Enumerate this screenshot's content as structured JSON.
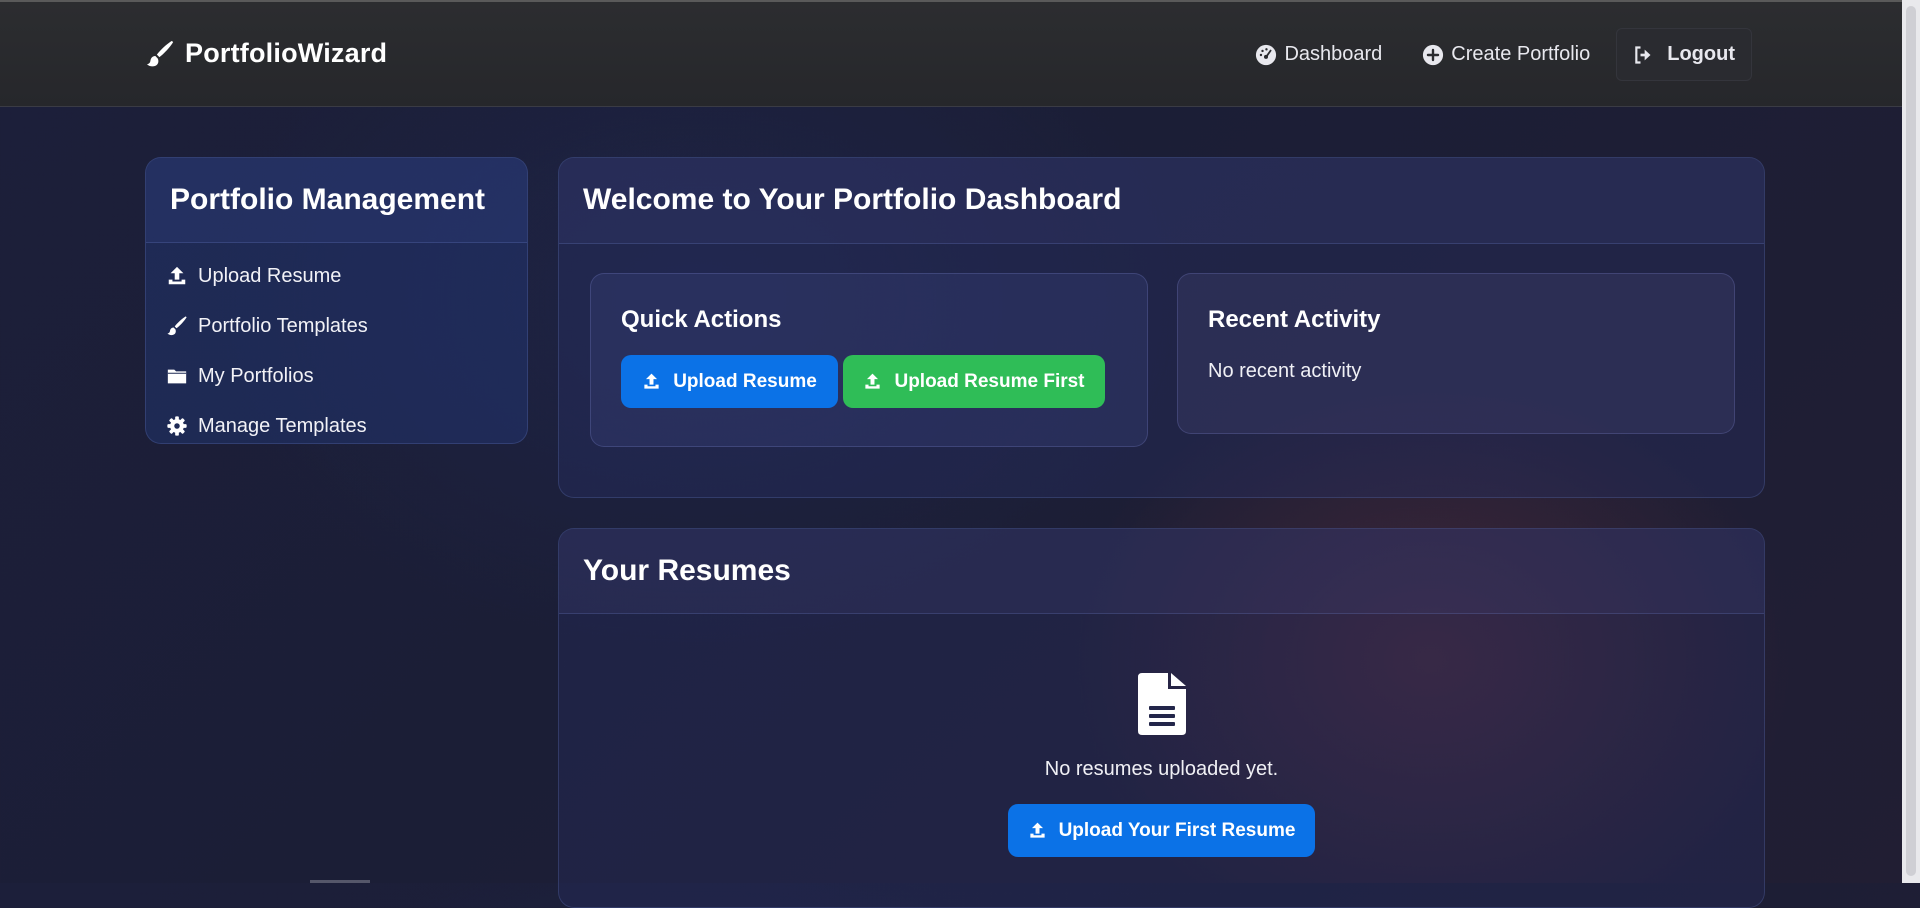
{
  "navbar": {
    "brand": "PortfolioWizard",
    "brand_icon": "paintbrush-icon",
    "links": {
      "dashboard": "Dashboard",
      "create_portfolio": "Create Portfolio",
      "logout": "Logout"
    }
  },
  "sidebar": {
    "title": "Portfolio Management",
    "items": [
      {
        "label": "Upload Resume",
        "icon": "upload-icon"
      },
      {
        "label": "Portfolio Templates",
        "icon": "paintbrush-icon"
      },
      {
        "label": "My Portfolios",
        "icon": "folder-icon"
      },
      {
        "label": "Manage Templates",
        "icon": "gear-icon"
      }
    ]
  },
  "welcome": {
    "title": "Welcome to Your Portfolio Dashboard",
    "quick_actions": {
      "title": "Quick Actions",
      "upload_resume": "Upload Resume",
      "upload_resume_first": "Upload Resume First"
    },
    "recent_activity": {
      "title": "Recent Activity",
      "empty": "No recent activity"
    }
  },
  "resumes": {
    "title": "Your Resumes",
    "empty": "No resumes uploaded yet.",
    "upload_first": "Upload Your First Resume"
  },
  "colors": {
    "primary": "#0b72e7",
    "success": "#2fbd57",
    "navbar": "#2a2b2f",
    "background": "#1c1f3a"
  }
}
